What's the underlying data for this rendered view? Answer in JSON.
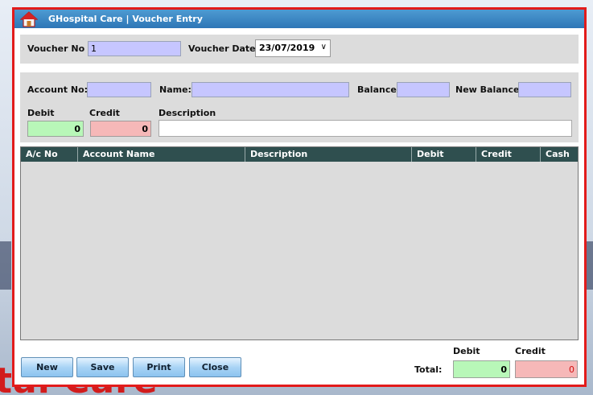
{
  "window": {
    "title": "GHospital Care  | Voucher Entry"
  },
  "background": {
    "text": "tal Care"
  },
  "voucher": {
    "no_label": "Voucher No",
    "no_value": "1",
    "date_label": "Voucher Date",
    "date_value": "23/07/2019"
  },
  "account": {
    "no_label": "Account No:",
    "name_label": "Name:",
    "balance_label": "Balance",
    "new_balance_label": "New Balance",
    "debit_label": "Debit",
    "debit_value": "0",
    "credit_label": "Credit",
    "credit_value": "0",
    "description_label": "Description"
  },
  "grid": {
    "columns": [
      "A/c No",
      "Account Name",
      "Description",
      "Debit",
      "Credit",
      "Cash"
    ]
  },
  "buttons": {
    "new": "New",
    "save": "Save",
    "print": "Print",
    "close": "Close"
  },
  "totals": {
    "label": "Total:",
    "debit_label": "Debit",
    "debit_value": "0",
    "credit_label": "Credit",
    "credit_value": "0"
  },
  "colors": {
    "accent_border": "#e21b1b",
    "titlebar": "#2d76b6",
    "grid_header": "#2f4f4f"
  }
}
